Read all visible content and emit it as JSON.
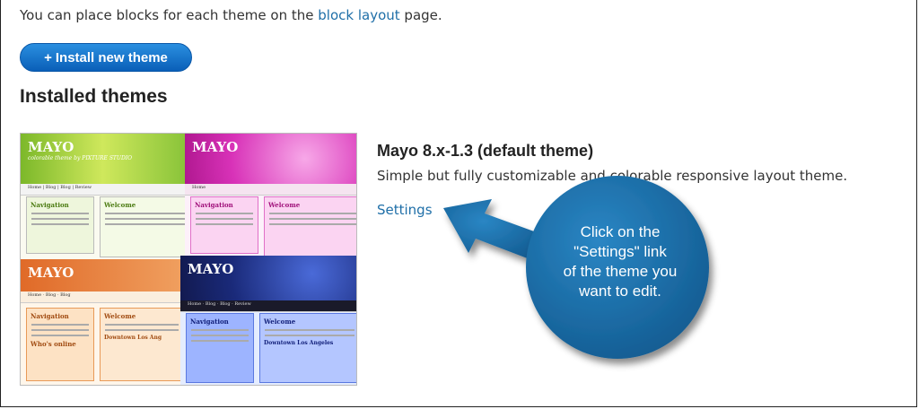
{
  "intro": {
    "prefix": "You can place blocks for each theme on the",
    "link": "block layout",
    "suffix": "page."
  },
  "install_button": {
    "icon": "+",
    "label": "Install new theme"
  },
  "section_heading": "Installed themes",
  "theme": {
    "title": "Mayo 8.x-1.3 (default theme)",
    "description": "Simple but fully customizable and colorable responsive layout theme.",
    "settings_link": "Settings"
  },
  "screenshot": {
    "logo": "MAYO",
    "tagline": "colorable theme by PIXTURE STUDIO",
    "nav": "Home  |  Blog  |  Blog  |  Review",
    "sidebar_title": "Navigation",
    "welcome": "Welcome",
    "downtown": "Downtown Los Angeles",
    "whos_online": "Who's online",
    "colors": {
      "green": "#9bd23c",
      "pink": "#e040b8",
      "orange": "#e8863a",
      "blue": "#23337a"
    }
  },
  "callout": {
    "lines": [
      "Click on the",
      "\"Settings\" link",
      "of the theme you",
      "want to edit."
    ],
    "color": "#1a6fa8"
  }
}
